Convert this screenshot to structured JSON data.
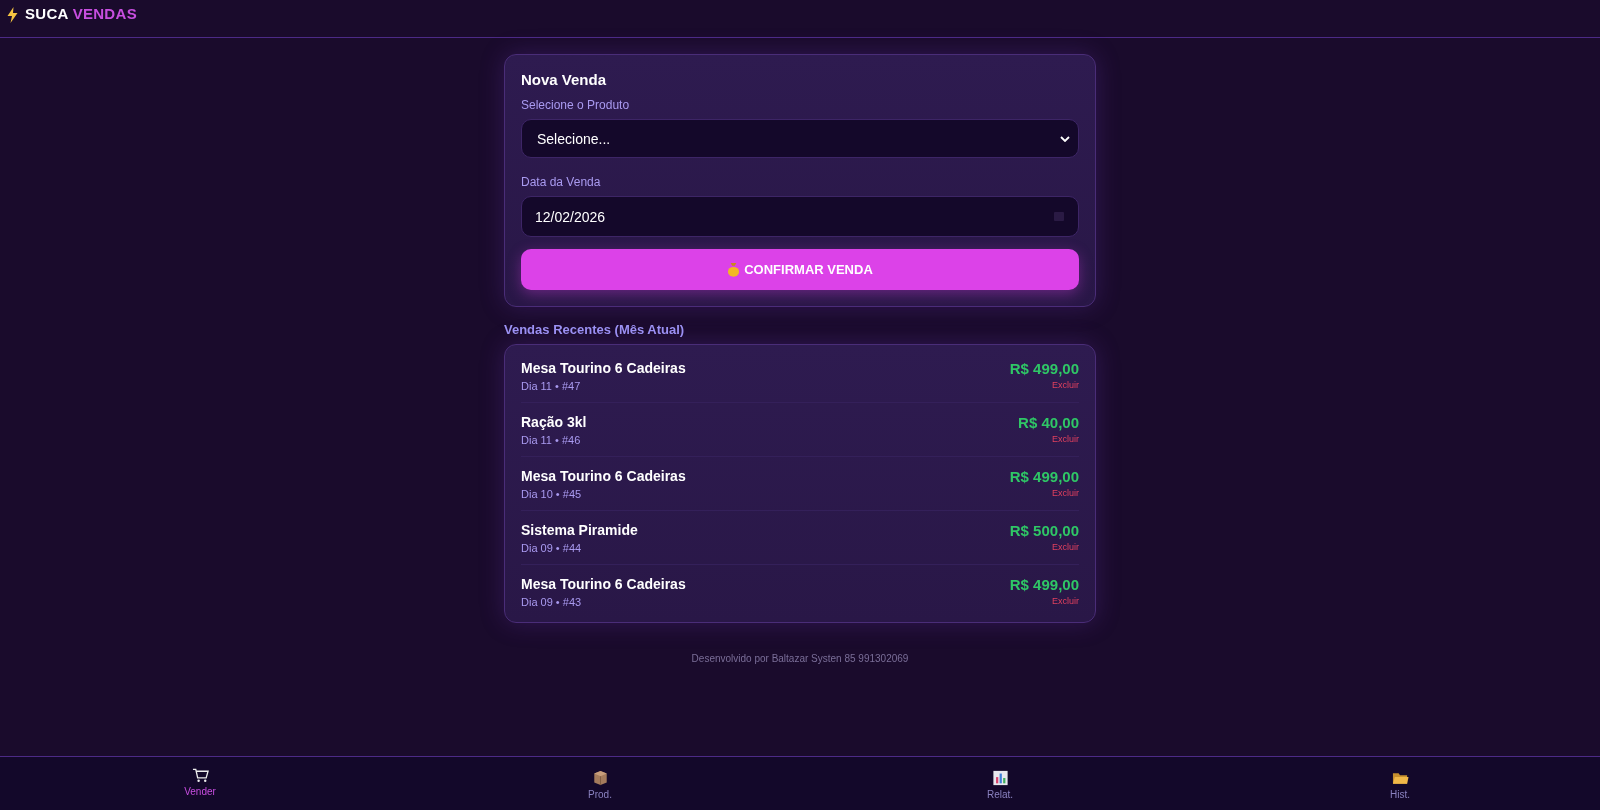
{
  "header": {
    "brand_primary": "SUCA",
    "brand_accent": "VENDAS"
  },
  "form": {
    "title": "Nova Venda",
    "product_label": "Selecione o Produto",
    "product_value": "Selecione...",
    "date_label": "Data da Venda",
    "date_value": "12/02/2026",
    "submit": "CONFIRMAR VENDA"
  },
  "recent": {
    "title": "Vendas Recentes (Mês Atual)",
    "items": [
      {
        "name": "Mesa Tourino 6 Cadeiras",
        "meta": "Dia 11 • #47",
        "price": "R$ 499,00",
        "action": "Excluir"
      },
      {
        "name": "Ração 3kl",
        "meta": "Dia 11 • #46",
        "price": "R$ 40,00",
        "action": "Excluir"
      },
      {
        "name": "Mesa Tourino 6 Cadeiras",
        "meta": "Dia 10 • #45",
        "price": "R$ 499,00",
        "action": "Excluir"
      },
      {
        "name": "Sistema Piramide",
        "meta": "Dia 09 • #44",
        "price": "R$ 500,00",
        "action": "Excluir"
      },
      {
        "name": "Mesa Tourino 6 Cadeiras",
        "meta": "Dia 09 • #43",
        "price": "R$ 499,00",
        "action": "Excluir"
      }
    ]
  },
  "footer": "Desenvolvido por Baltazar Systen 85 991302069",
  "nav": [
    {
      "label": "Vender",
      "kind": "cart",
      "selected": true
    },
    {
      "label": "Prod.",
      "kind": "box",
      "selected": false
    },
    {
      "label": "Relat.",
      "kind": "chart",
      "selected": false
    },
    {
      "label": "Hist.",
      "kind": "folder",
      "selected": false
    }
  ]
}
